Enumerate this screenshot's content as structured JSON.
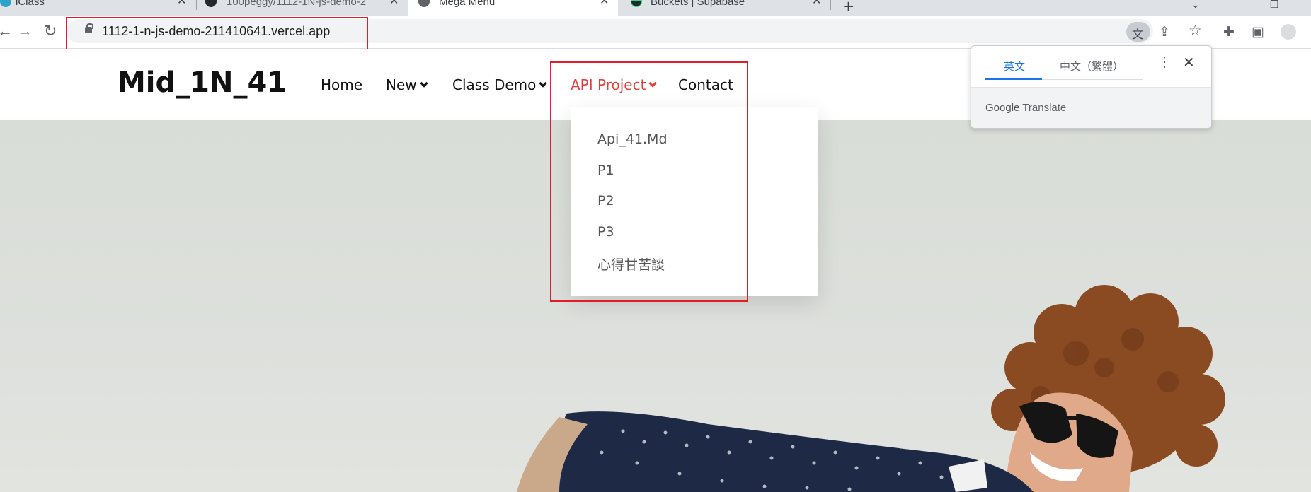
{
  "browser": {
    "tabs": [
      {
        "title": "iClass",
        "active": false
      },
      {
        "title": "100peggy/1112-1N-js-demo-2",
        "active": false
      },
      {
        "title": "Mega Menu",
        "active": true
      },
      {
        "title": "Buckets | Supabase",
        "active": false
      }
    ],
    "new_tab_label": "+",
    "url": "1112-1-n-js-demo-211410641.vercel.app",
    "icons": [
      "back-icon",
      "forward-icon",
      "reload-icon",
      "lock-icon",
      "translate-icon",
      "share-icon",
      "star-icon",
      "extensions-icon",
      "side-panel-icon",
      "profile-icon"
    ]
  },
  "site": {
    "logo": "Mid_1N_41",
    "nav": [
      {
        "label": "Home",
        "has_dropdown": false
      },
      {
        "label": "New",
        "has_dropdown": true
      },
      {
        "label": "Class Demo",
        "has_dropdown": true
      },
      {
        "label": "API Project",
        "has_dropdown": true,
        "active": true
      },
      {
        "label": "Contact",
        "has_dropdown": false
      }
    ],
    "dropdown_items": [
      "Api_41.Md",
      "P1",
      "P2",
      "P3",
      "心得甘苦談"
    ],
    "accent_color": "#e73c3c"
  },
  "translate_popup": {
    "tabs": [
      "英文",
      "中文（繁體）"
    ],
    "brand_google": "Google",
    "brand_translate": "Translate"
  },
  "annotation_color": "#e11d2a"
}
